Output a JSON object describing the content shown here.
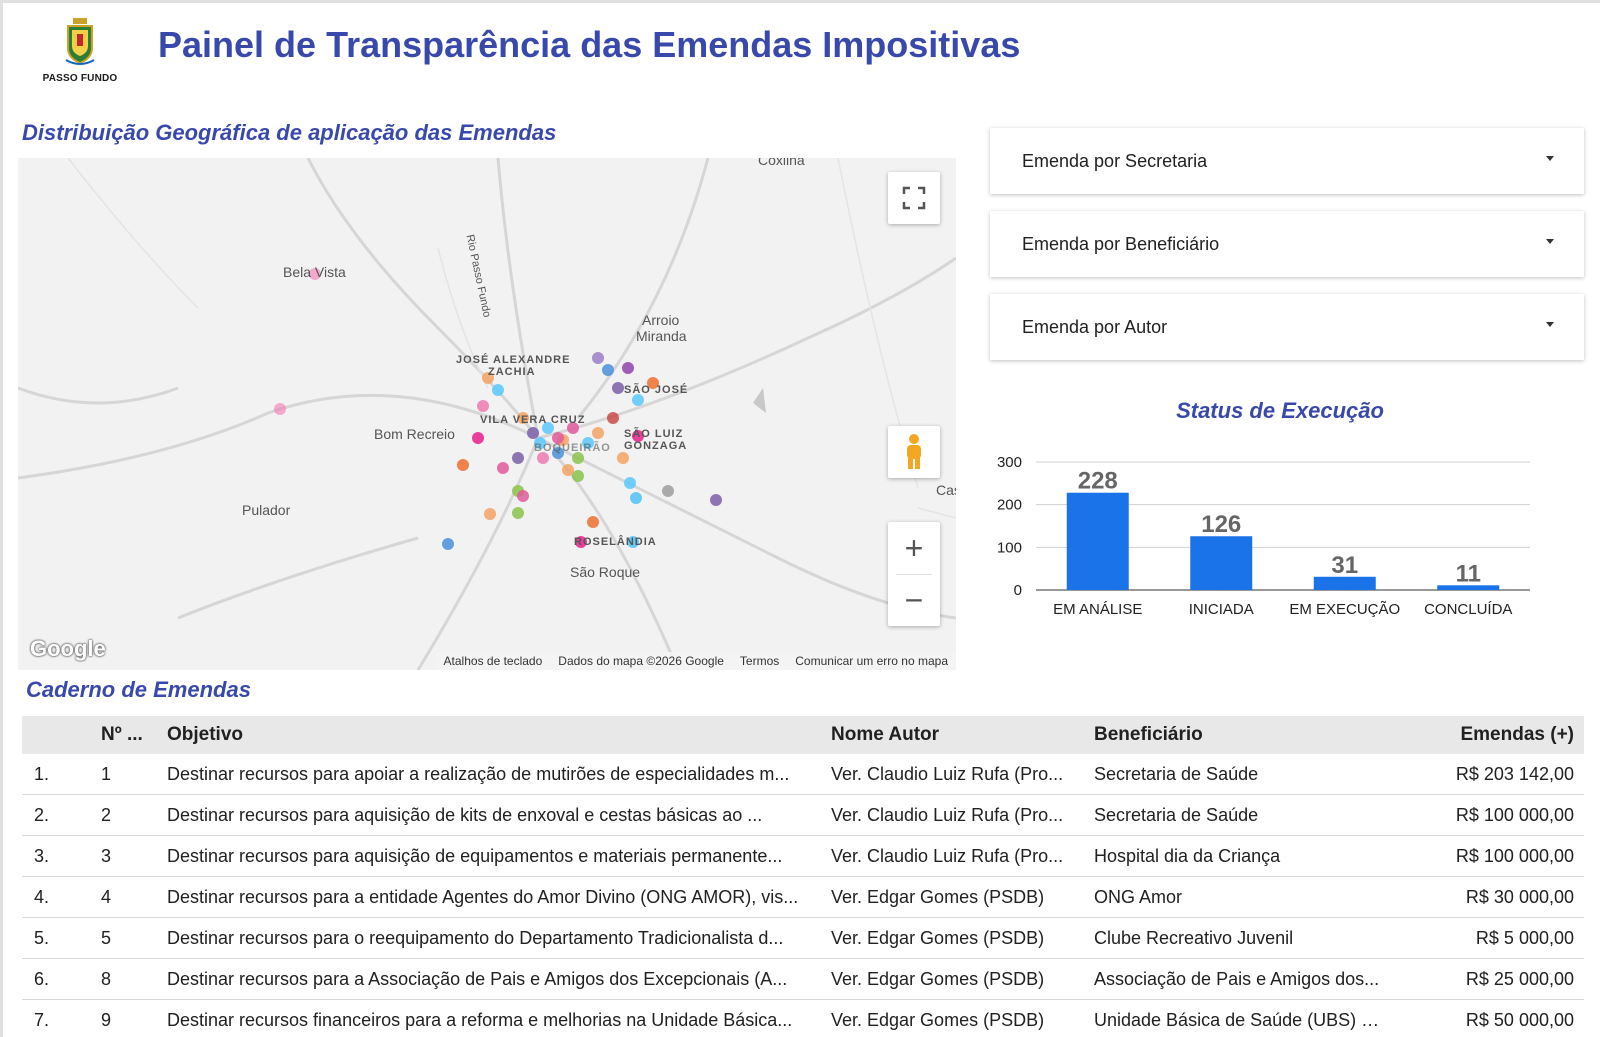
{
  "header": {
    "title": "Painel de Transparência das Emendas Impositivas",
    "logo_text": "PASSO FUNDO"
  },
  "map_section": {
    "title": "Distribuição Geográfica de aplicação das Emendas",
    "labels": [
      "Coxilha",
      "Bela Vista",
      "Rio Passo Fundo",
      "Arroio",
      "Miranda",
      "JOSÉ ALEXANDRE",
      "ZACHIA",
      "SÃO JOSÉ",
      "VILA VERA CRUZ",
      "Bom Recreio",
      "SÃO LUIZ",
      "GONZAGA",
      "Pulador",
      "BOQUEIRÃO",
      "ROSELÂNDIA",
      "São Roque",
      "Cas"
    ],
    "footer": [
      "Atalhos de teclado",
      "Dados do mapa ©2026 Google",
      "Termos",
      "Comunicar um erro no mapa"
    ],
    "google_logo": "Google",
    "fullscreen_icon": "fullscreen-icon",
    "pegman_icon": "pegman-icon",
    "zoom_in": "+",
    "zoom_out": "−"
  },
  "filters": [
    {
      "label": "Emenda por Secretaria"
    },
    {
      "label": "Emenda por Beneficiário"
    },
    {
      "label": "Emenda por Autor"
    }
  ],
  "chart_title": "Status de Execução",
  "chart_data": {
    "type": "bar",
    "title": "Status de Execução",
    "categories": [
      "EM ANÁLISE",
      "INICIADA",
      "EM EXECUÇÃO",
      "CONCLUÍDA"
    ],
    "values": [
      228,
      126,
      31,
      11
    ],
    "ylim": [
      0,
      300
    ],
    "yticks": [
      0,
      100,
      200,
      300
    ],
    "grid": true,
    "bar_color": "#1a73e8",
    "xlabel": "",
    "ylabel": ""
  },
  "table_section": {
    "title": "Caderno de Emendas",
    "headers": {
      "num": "Nº ...",
      "objetivo": "Objetivo",
      "autor": "Nome Autor",
      "beneficiario": "Beneficiário",
      "valor": "Emendas (+)"
    },
    "rows": [
      {
        "idx": "1.",
        "num": "1",
        "objetivo": "Destinar recursos para apoiar a realização de mutirões de especialidades m...",
        "autor": "Ver. Claudio Luiz Rufa (Pro...",
        "beneficiario": "Secretaria de Saúde",
        "valor": "R$ 203 142,00"
      },
      {
        "idx": "2.",
        "num": "2",
        "objetivo": "Destinar recursos para aquisição de kits de enxoval e cestas básicas ao ...",
        "autor": "Ver. Claudio Luiz Rufa (Pro...",
        "beneficiario": "Secretaria de Saúde",
        "valor": "R$ 100 000,00"
      },
      {
        "idx": "3.",
        "num": "3",
        "objetivo": "Destinar recursos para aquisição de equipamentos e materiais permanente...",
        "autor": "Ver. Claudio Luiz Rufa (Pro...",
        "beneficiario": "Hospital dia da Criança",
        "valor": "R$ 100 000,00"
      },
      {
        "idx": "4.",
        "num": "4",
        "objetivo": "Destinar recursos para a entidade Agentes do Amor Divino (ONG AMOR), vis...",
        "autor": "Ver. Edgar Gomes (PSDB)",
        "beneficiario": "ONG Amor",
        "valor": "R$ 30 000,00"
      },
      {
        "idx": "5.",
        "num": "5",
        "objetivo": "Destinar recursos para o reequipamento do Departamento Tradicionalista d...",
        "autor": "Ver. Edgar Gomes (PSDB)",
        "beneficiario": "Clube Recreativo Juvenil",
        "valor": "R$ 5 000,00"
      },
      {
        "idx": "6.",
        "num": "8",
        "objetivo": "Destinar recursos para a Associação de Pais e Amigos dos Excepcionais (A...",
        "autor": "Ver. Edgar Gomes (PSDB)",
        "beneficiario": "Associação de Pais e Amigos dos...",
        "valor": "R$ 25 000,00"
      },
      {
        "idx": "7.",
        "num": "9",
        "objetivo": "Destinar recursos financeiros para a reforma e melhorias na Unidade Básica...",
        "autor": "Ver. Edgar Gomes (PSDB)",
        "beneficiario": "Unidade Básica de Saúde (UBS) e ...",
        "valor": "R$ 50 000,00"
      }
    ]
  },
  "colors": {
    "title_blue": "#3949ab",
    "bar_blue": "#1a73e8"
  }
}
